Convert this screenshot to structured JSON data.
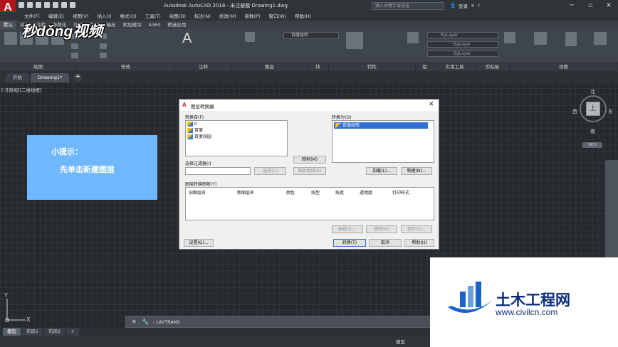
{
  "titlebar": {
    "app_logo": "A",
    "window_title": "Autodesk AutoCAD 2018 - 未注册版     Drawing1.dwg",
    "search_placeholder": "键入关键字或短语",
    "login": "登录"
  },
  "menu": [
    "文件(F)",
    "编辑(E)",
    "视图(V)",
    "插入(I)",
    "格式(O)",
    "工具(T)",
    "绘图(D)",
    "标注(N)",
    "修改(M)",
    "参数(P)",
    "窗口(W)",
    "帮助(H)"
  ],
  "ribbon_tabs": [
    "默认",
    "插入",
    "注释",
    "参数化",
    "视图",
    "管理",
    "输出",
    "附加模块",
    "A360",
    "精选应用"
  ],
  "ribbon_panels": [
    "绘图",
    "修改",
    "注释",
    "图层",
    "块",
    "特性",
    "组",
    "实用工具",
    "剪贴板",
    "视图"
  ],
  "ribbon_props": {
    "layer_current": "百度经验",
    "prop1": "ByLayer",
    "prop2": "ByLayer",
    "prop3": "ByLayer"
  },
  "brand_overlay": "秒dǒng视频",
  "doc_tabs": [
    "开始",
    "Drawing1*"
  ],
  "viewport_label": "[-][俯视][二维线框]",
  "viewcube": {
    "top": "上",
    "north": "北",
    "south": "南",
    "east": "东",
    "west": "西",
    "wcs": "WCS"
  },
  "hint": {
    "title": "小提示：",
    "text": "先单击新建图层"
  },
  "dialog": {
    "title": "图层转换器",
    "convert_from_label": "转换自(F)",
    "convert_from_items": [
      "0",
      "百度",
      "百度校园"
    ],
    "convert_to_label": "转换为(O)",
    "convert_to_items": [
      "百度经验"
    ],
    "map_button": "映射(M)",
    "map_same_button": "映射相同(A)",
    "filter_label": "选择过滤器(I)",
    "filter_value": "",
    "select_button": "选择(C)",
    "load_button": "加载(L)...",
    "new_button": "新建(N)...",
    "mapping_label": "图层转换映射(Y)",
    "columns": [
      "旧图层名",
      "新图层名",
      "颜色",
      "线型",
      "线宽",
      "透明度",
      "打印样式"
    ],
    "edit_button": "编辑(E)...",
    "delete_button": "删除(R)",
    "save_button": "保存(S)...",
    "settings_button": "设置(G)...",
    "translate_button": "转换(T)",
    "cancel_button": "取消",
    "help_button": "帮助(H)"
  },
  "command_line": {
    "text": "- LAYTRANS"
  },
  "ucs": {
    "x": "X",
    "y": "Y"
  },
  "layout_tabs": [
    "模型",
    "布局1",
    "布局2"
  ],
  "status": {
    "model": "模型"
  },
  "watermark": {
    "brand": "土木工程网",
    "url": "www.civilcn.com"
  },
  "colors": {
    "hint_bg": "#6fb7ff",
    "selection": "#2f6fd6",
    "logo_red": "#b3161b"
  }
}
